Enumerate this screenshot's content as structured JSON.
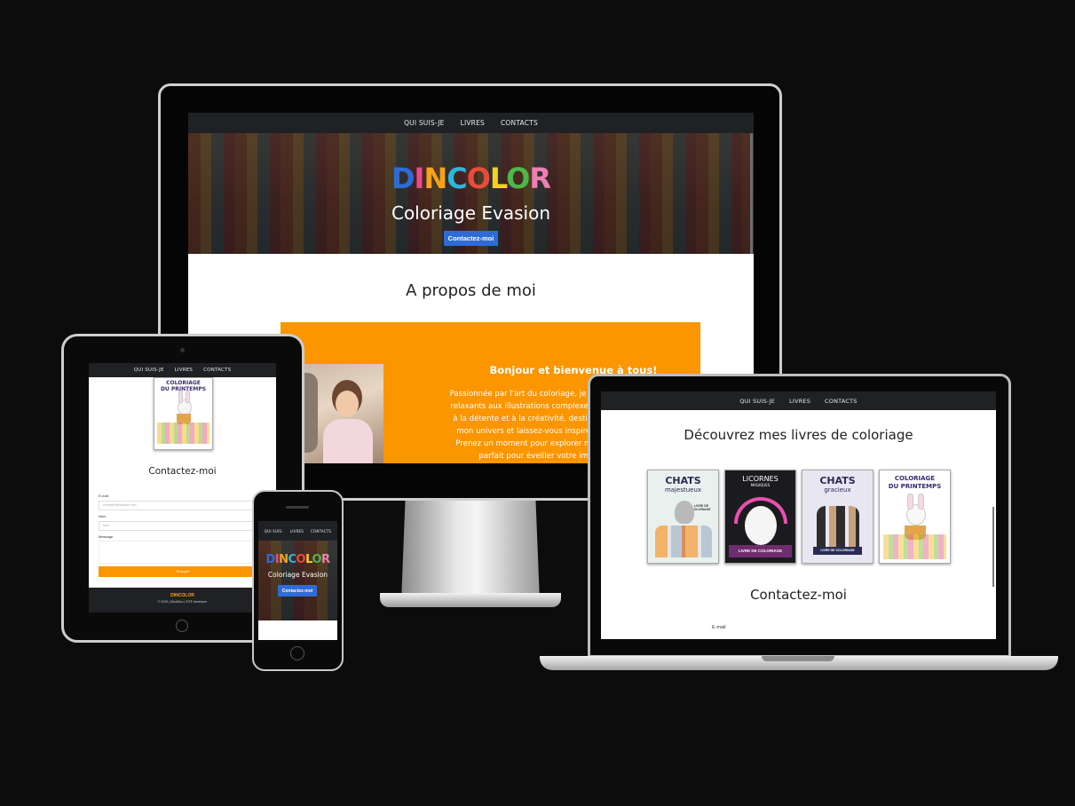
{
  "nav": {
    "items": [
      "QUI SUIS-JE",
      "LIVRES",
      "CONTACTS"
    ]
  },
  "phone_nav": {
    "items": [
      "QUI SUIS-",
      "LIVRES",
      "CONTACTS"
    ]
  },
  "logo": {
    "letters": [
      "D",
      "I",
      "N",
      "C",
      "O",
      "L",
      "O",
      "R"
    ],
    "colors": [
      "#2f6bd6",
      "#e94b8a",
      "#f7a21b",
      "#2fb6d9",
      "#e94b3c",
      "#f7d21b",
      "#4cb84a",
      "#ef7fb2"
    ]
  },
  "hero": {
    "title": "Coloriage Evasion",
    "cta": "Contactez-moi"
  },
  "about": {
    "title": "A propos de moi",
    "greeting": "Bonjour et bienvenue à tous!",
    "lines": [
      "Passionnée par l'art du coloriage, je crée des livres",
      "relaxants aux illustrations complexes. Chaque pag",
      "à la détente et à la créativité, destinée à tous les",
      "mon univers et laissez-vous inspirer par mes cr",
      "Prenez un moment pour explorer mes ouvrages",
      "parfait pour éveiller votre imaginati"
    ]
  },
  "books_section": {
    "title": "Découvrez mes livres de coloriage",
    "books": [
      {
        "title": "CHATS",
        "subtitle": "majestueux",
        "badge": "LIVRE DE COLORIAGE",
        "bg": "#e9f1ee"
      },
      {
        "title": "LICORNES",
        "subtitle": "MAGIQUES",
        "badge": "LIVRE DE COLORIAGE",
        "bg": "#1b1b1f"
      },
      {
        "title": "CHATS",
        "subtitle": "gracieux",
        "badge": "LIVRE DE COLORIAGE",
        "bg": "#e8e6f1"
      },
      {
        "title": "COLORIAGE",
        "subtitle": "DU PRINTEMPS",
        "badge": "",
        "bg": "#ffffff"
      }
    ]
  },
  "contact": {
    "title": "Contactez-moi",
    "email_label": "E-mail",
    "email_placeholder": "exemple@example.com",
    "name_label": "Nom",
    "name_placeholder": "Nom",
    "message_label": "Message",
    "submit": "Envoyer"
  },
  "tablet_book": {
    "title": "COLORIAGE",
    "subtitle": "DU PRINTEMPS"
  },
  "footer": {
    "brand": "DINCOLOR",
    "copyright": "© 2025 | DinaDino | SITE developer"
  },
  "colors": {
    "accent_orange": "#fb9500",
    "nav_dark": "#1f2124",
    "button_blue": "#2f6bd6"
  }
}
